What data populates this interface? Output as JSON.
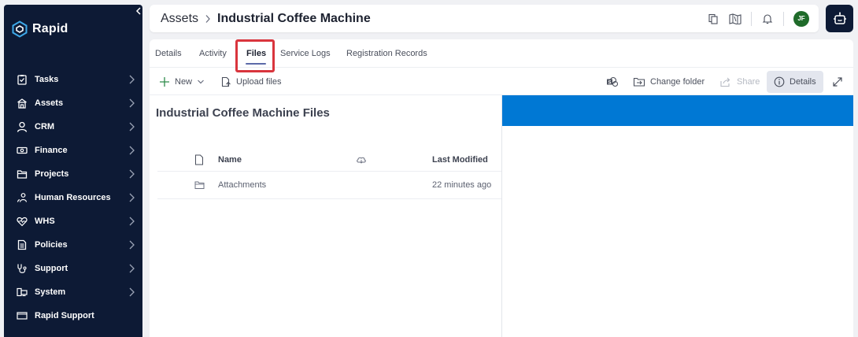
{
  "sidebar": {
    "logo_text": "Rapid",
    "items": [
      {
        "label": "Tasks",
        "icon": "tasks-icon",
        "has_chevron": true
      },
      {
        "label": "Assets",
        "icon": "assets-icon",
        "has_chevron": true
      },
      {
        "label": "CRM",
        "icon": "person-icon",
        "has_chevron": true
      },
      {
        "label": "Finance",
        "icon": "money-icon",
        "has_chevron": true
      },
      {
        "label": "Projects",
        "icon": "folder-icon",
        "has_chevron": true
      },
      {
        "label": "Human Resources",
        "icon": "people-icon",
        "has_chevron": true
      },
      {
        "label": "WHS",
        "icon": "heart-pulse-icon",
        "has_chevron": true
      },
      {
        "label": "Policies",
        "icon": "document-icon",
        "has_chevron": true
      },
      {
        "label": "Support",
        "icon": "stethoscope-icon",
        "has_chevron": true
      },
      {
        "label": "System",
        "icon": "system-icon",
        "has_chevron": true
      },
      {
        "label": "Rapid Support",
        "icon": "window-icon",
        "has_chevron": false
      }
    ]
  },
  "header": {
    "breadcrumb_parent": "Assets",
    "breadcrumb_current": "Industrial Coffee Machine",
    "avatar_initials": "JF"
  },
  "tabs": [
    "Details",
    "Activity",
    "Files",
    "Service Logs",
    "Registration Records"
  ],
  "active_tab": "Files",
  "toolbar": {
    "new_label": "New",
    "upload_label": "Upload files",
    "change_folder_label": "Change folder",
    "share_label": "Share",
    "details_label": "Details"
  },
  "files": {
    "title": "Industrial Coffee Machine Files",
    "columns": {
      "name": "Name",
      "modified": "Last Modified"
    },
    "rows": [
      {
        "name": "Attachments",
        "modified": "22 minutes ago",
        "type": "folder"
      }
    ]
  },
  "colors": {
    "sidebar_bg": "#0d1a35",
    "details_banner": "#0078d4",
    "tab_highlight": "#d9353d",
    "avatar": "#1f6b2a"
  }
}
